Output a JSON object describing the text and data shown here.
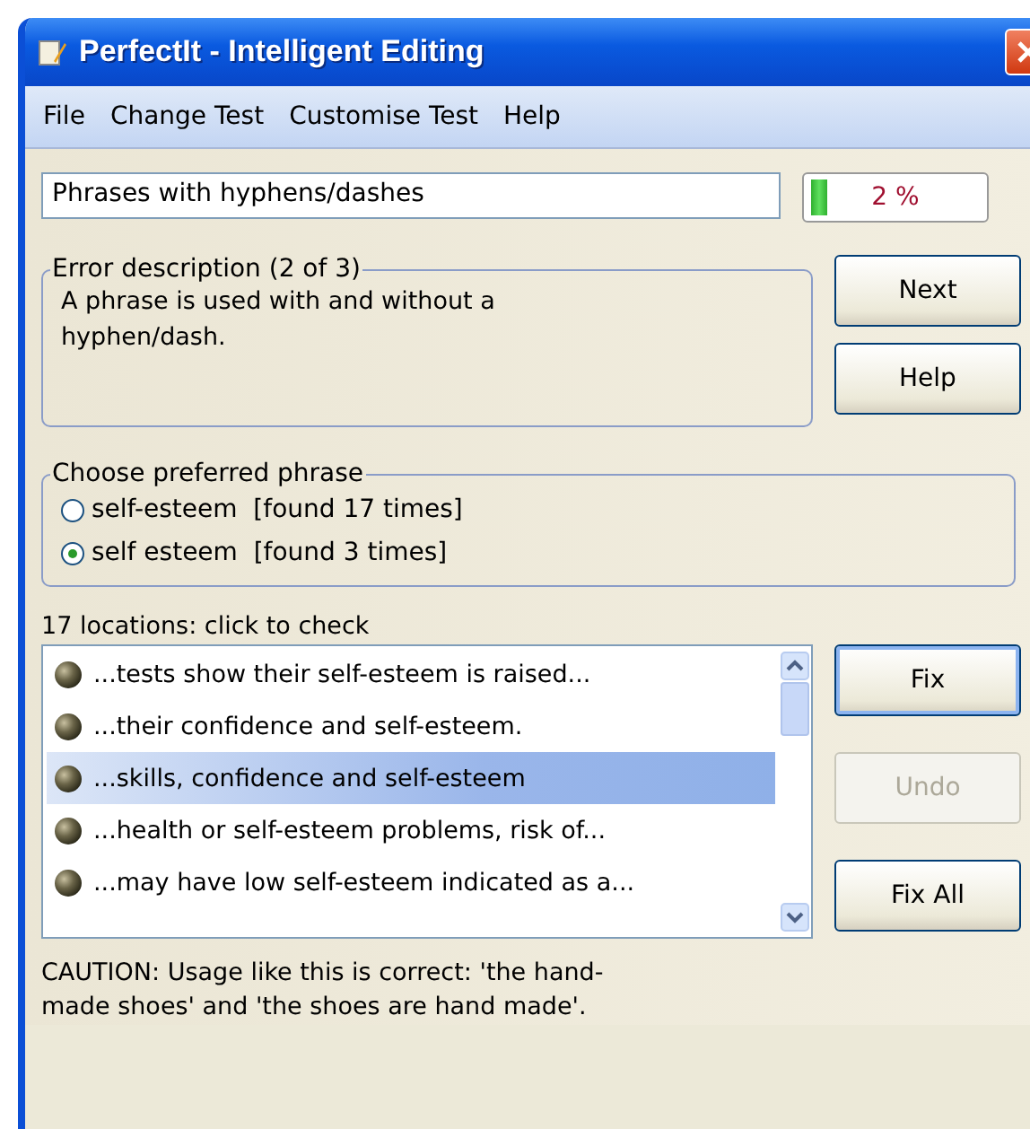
{
  "window": {
    "title": "PerfectIt - Intelligent Editing"
  },
  "menu": [
    "File",
    "Change Test",
    "Customise Test",
    "Help"
  ],
  "test_field": {
    "value": "Phrases with hyphens/dashes"
  },
  "progress": {
    "level": 0.1,
    "reading": "2 %"
  },
  "error_description": {
    "title": "Error description (2 of 3)",
    "text": "A phrase is used with and without a hyphen/dash."
  },
  "side_buttons": [
    {
      "label": "Next",
      "disabled": false
    },
    {
      "label": "Help",
      "disabled": false
    }
  ],
  "preferred_phrase": {
    "title": "Choose preferred phrase",
    "options": [
      {
        "label": "self-esteem  [found 17 times]",
        "selected": false
      },
      {
        "label": "self esteem  [found 3 times]",
        "selected": true
      }
    ]
  },
  "locations": {
    "label": "17 locations: click to check",
    "items": [
      {
        "text": "...tests show their self-esteem is raised...",
        "selected": false
      },
      {
        "text": "...their confidence and self-esteem.",
        "selected": false
      },
      {
        "text": "...skills, confidence and self-esteem",
        "selected": true
      },
      {
        "text": "...health or self-esteem problems, risk of...",
        "selected": false
      },
      {
        "text": "...may have low self-esteem indicated as a...",
        "selected": false
      }
    ]
  },
  "fix_buttons": [
    {
      "label": "Fix",
      "disabled": false
    },
    {
      "label": "Undo",
      "disabled": true
    },
    {
      "label": "Fix All",
      "disabled": false
    }
  ],
  "caution": "CAUTION: Usage like this is correct: 'the hand-made shoes' and 'the shoes are hand made'."
}
